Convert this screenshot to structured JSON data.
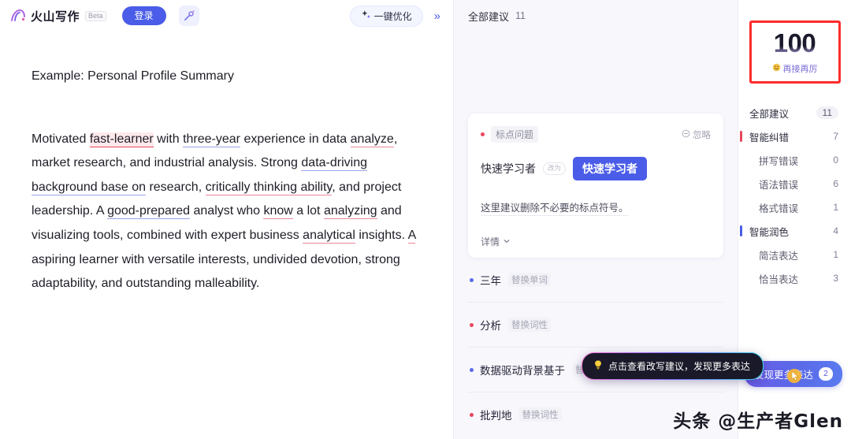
{
  "header": {
    "brand_name": "火山写作",
    "beta_tag": "Beta",
    "login_label": "登录",
    "magic_icon": "magic-wand-icon",
    "optimize_label": "一键优化",
    "optimize_icon": "sparkle-icon",
    "collapse_icon": "double-chevron-right-icon"
  },
  "editor": {
    "title": "Example: Personal Profile Summary",
    "paragraph_segments": [
      {
        "text": "Motivated ",
        "mark": "none"
      },
      {
        "text": "fast-learner",
        "mark": "error-highlight"
      },
      {
        "text": " with ",
        "mark": "none"
      },
      {
        "text": "three-year",
        "mark": "polish-underline"
      },
      {
        "text": " experience in data ",
        "mark": "none"
      },
      {
        "text": "analyze",
        "mark": "error-underline"
      },
      {
        "text": ", market research, and industrial analysis. Strong ",
        "mark": "none"
      },
      {
        "text": "data-driving background base on",
        "mark": "polish-underline"
      },
      {
        "text": " research, ",
        "mark": "none"
      },
      {
        "text": "critically thinking ability",
        "mark": "error-underline"
      },
      {
        "text": ", and project leadership. A ",
        "mark": "none"
      },
      {
        "text": "good-prepared",
        "mark": "polish-underline"
      },
      {
        "text": " analyst who ",
        "mark": "none"
      },
      {
        "text": "know",
        "mark": "error-underline"
      },
      {
        "text": " a lot ",
        "mark": "none"
      },
      {
        "text": "analyzing",
        "mark": "error-underline"
      },
      {
        "text": " and visualizing tools, combined with expert business ",
        "mark": "none"
      },
      {
        "text": "analytical",
        "mark": "error-underline"
      },
      {
        "text": " insights. ",
        "mark": "none"
      },
      {
        "text": "A",
        "mark": "error-underline"
      },
      {
        "text": " aspiring learner with versatile interests, undivided devotion, strong adaptability, and outstanding malleability.",
        "mark": "none"
      }
    ]
  },
  "suggestions_panel": {
    "header_label": "全部建议",
    "header_count": "11",
    "card": {
      "category": "标点问题",
      "category_dot": "red",
      "ignore_label": "忽略",
      "ignore_icon": "circle-minus-icon",
      "original": "快速学习者",
      "arrow_icon": "replace-arrow-icon",
      "arrow_label": "改为",
      "replacement": "快速学习者",
      "description": "这里建议删除不必要的标点符号。",
      "detail_label": "详情",
      "detail_icon": "chevron-down-icon"
    },
    "rows": [
      {
        "word": "三年",
        "kind": "替换单词",
        "dot": "blue"
      },
      {
        "word": "分析",
        "kind": "替换词性",
        "dot": "red"
      },
      {
        "word": "数据驱动背景基于",
        "kind": "替换短语",
        "dot": "blue"
      },
      {
        "word": "批判地",
        "kind": "替换词性",
        "dot": "red"
      }
    ]
  },
  "tooltip": {
    "icon": "lightbulb-icon",
    "text": "点击查看改写建议，发现更多表达"
  },
  "stats": {
    "score": "100",
    "score_sub": "再接再厉",
    "score_emoji": "emoji-smile-icon",
    "highlight_color": "#fb2c2c",
    "items": [
      {
        "label": "全部建议",
        "count": "11",
        "level": "head",
        "group": "none",
        "pill": true
      },
      {
        "label": "智能纠错",
        "count": "7",
        "level": "head",
        "group": "err",
        "pill": false
      },
      {
        "label": "拼写错误",
        "count": "0",
        "level": "sub",
        "group": "none",
        "pill": false
      },
      {
        "label": "语法错误",
        "count": "6",
        "level": "sub",
        "group": "none",
        "pill": false
      },
      {
        "label": "格式错误",
        "count": "1",
        "level": "sub",
        "group": "none",
        "pill": false
      },
      {
        "label": "智能润色",
        "count": "4",
        "level": "head",
        "group": "pol",
        "pill": false
      },
      {
        "label": "简洁表达",
        "count": "1",
        "level": "sub",
        "group": "none",
        "pill": false
      },
      {
        "label": "恰当表达",
        "count": "3",
        "level": "sub",
        "group": "none",
        "pill": false
      }
    ],
    "discover_label": "发现更多表达",
    "discover_badge": "2",
    "cursor_icon": "mouse-pointer-icon"
  },
  "watermark": {
    "text": "头条 @生产者Glen"
  },
  "colors": {
    "accent_blue": "#4a5ce8",
    "error_red": "#e8465c",
    "polish_purple": "#6c5ce7",
    "highlight_red": "#fb2c2c",
    "panel_bg": "#f8f7fc"
  }
}
